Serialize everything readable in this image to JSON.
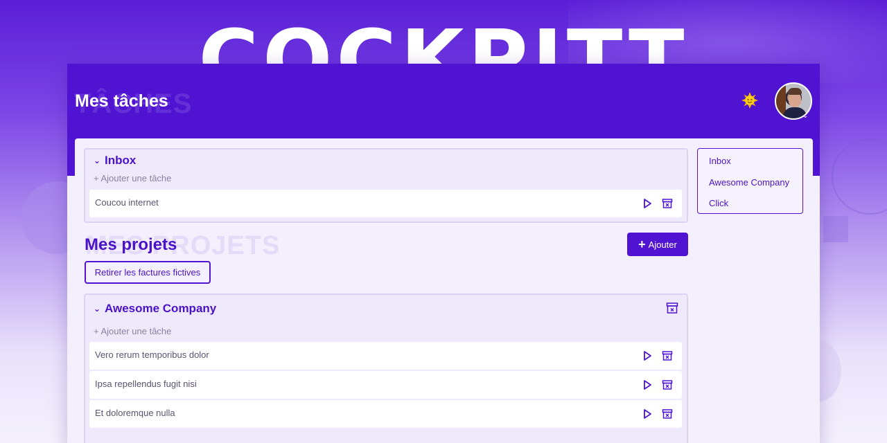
{
  "hero": {
    "title": "COCKPITT"
  },
  "header": {
    "title": "Mes tâches",
    "title_ghost": "TÂCHES",
    "theme_icon": "sun-icon",
    "avatar_icon": "user-avatar"
  },
  "inbox": {
    "title": "Inbox",
    "add_task": "+ Ajouter une tâche",
    "tasks": [
      {
        "label": "Coucou internet"
      }
    ]
  },
  "projects": {
    "title": "Mes projets",
    "title_ghost": "MES PROJETS",
    "add_button": "Ajouter",
    "remove_fake_invoices": "Retirer les factures fictives",
    "list": [
      {
        "title": "Awesome Company",
        "add_task": "+ Ajouter une tâche",
        "tasks": [
          {
            "label": "Vero rerum temporibus dolor"
          },
          {
            "label": "Ipsa repellendus fugit nisi"
          },
          {
            "label": "Et doloremque nulla"
          }
        ]
      }
    ]
  },
  "side_nav": {
    "items": [
      {
        "label": "Inbox"
      },
      {
        "label": "Awesome Company"
      },
      {
        "label": "Click"
      }
    ]
  },
  "colors": {
    "primary": "#5013d2",
    "accent_text": "#4a12c8",
    "background": "#f3effd"
  }
}
